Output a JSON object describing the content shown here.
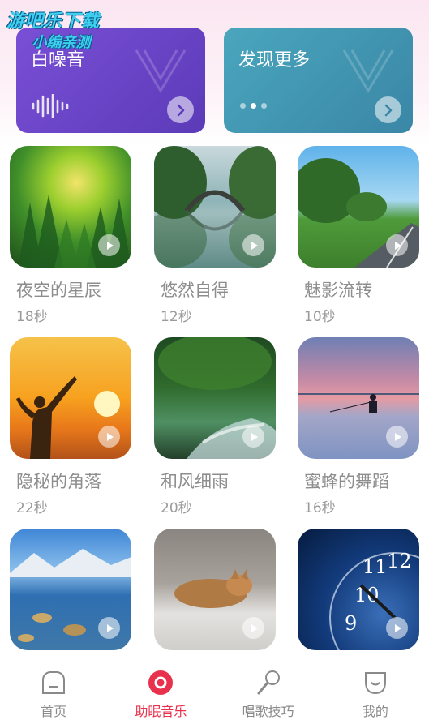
{
  "watermark": {
    "line1": "游吧乐下载",
    "line2": "小编亲测"
  },
  "cards": [
    {
      "title": "白噪音",
      "icon": "sound-wave-icon"
    },
    {
      "title": "发现更多",
      "icon": "carousel-dots-icon",
      "dots": 3,
      "active_dot": 2
    }
  ],
  "tracks": [
    {
      "name": "夜空的星辰",
      "duration": "18秒"
    },
    {
      "name": "悠然自得",
      "duration": "12秒"
    },
    {
      "name": "魅影流转",
      "duration": "10秒"
    },
    {
      "name": "隐秘的角落",
      "duration": "22秒"
    },
    {
      "name": "和风细雨",
      "duration": "20秒"
    },
    {
      "name": "蜜蜂的舞蹈",
      "duration": "16秒"
    },
    {
      "name": "",
      "duration": ""
    },
    {
      "name": "",
      "duration": ""
    },
    {
      "name": "",
      "duration": ""
    }
  ],
  "tabs": [
    {
      "label": "首页",
      "icon": "home-icon"
    },
    {
      "label": "助眠音乐",
      "icon": "record-icon",
      "active": true
    },
    {
      "label": "唱歌技巧",
      "icon": "microphone-icon"
    },
    {
      "label": "我的",
      "icon": "profile-icon"
    }
  ],
  "colors": {
    "accent": "#e8324d",
    "card_purple": "#6a45c8",
    "card_teal": "#4298b2"
  }
}
